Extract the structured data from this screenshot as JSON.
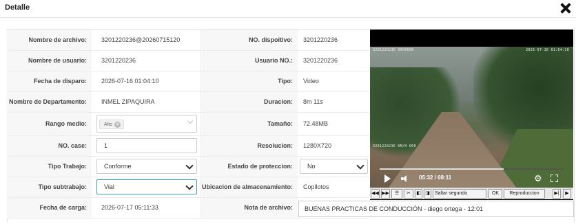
{
  "header": {
    "title": "Detalle"
  },
  "left": [
    {
      "label": "Nombre de archivo:",
      "value": "3201220236@20260715120"
    },
    {
      "label": "Nombre de usuario:",
      "value": "3201220236"
    },
    {
      "label": "Fecha de disparo:",
      "value": "2026-07-16 01:04:10"
    },
    {
      "label": "Nombre de Departamento:",
      "value": "INMEL ZIPAQUIRA"
    },
    {
      "label": "Rango medio:",
      "value": "Alto"
    },
    {
      "label": "NO. case:",
      "value": "1"
    },
    {
      "label": "Tipo Trabajo:",
      "value": "Conforme"
    },
    {
      "label": "Tipo subtrabajo:",
      "value": "Vial"
    },
    {
      "label": "Fecha de carga:",
      "value": "2026-07-17 05:11:33"
    }
  ],
  "right": [
    {
      "label": "NO. dispoitivo:",
      "value": "3201220236"
    },
    {
      "label": "Usuario NO.:",
      "value": "3201220236"
    },
    {
      "label": "Tipo:",
      "value": "Video"
    },
    {
      "label": "Duracion:",
      "value": "8m 11s"
    },
    {
      "label": "Tamaño:",
      "value": "72.48MB"
    },
    {
      "label": "Resolucion:",
      "value": "1280X720"
    },
    {
      "label": "Estado de proteccion:",
      "value": "No"
    },
    {
      "label": "Ubicacion de almacenamiento:",
      "value": "Copilotos"
    },
    {
      "label": "Nota de archivo:",
      "value": "BUENAS PRACTICAS DE CONDUCCIÓN - diego ortega - 12:01"
    }
  ],
  "player": {
    "time": "05:32 / 08:11",
    "progress": 0.676,
    "osd_top_left": "3201220236 0000000",
    "osd_top_right": "2026-07-16 01:04:10",
    "osd_bottom_left": "3201220236 KM/H 000",
    "toolbar": {
      "skip_label": "Saltar segundo",
      "ok_label": "OK",
      "playback_label": "Reproduccion"
    }
  }
}
